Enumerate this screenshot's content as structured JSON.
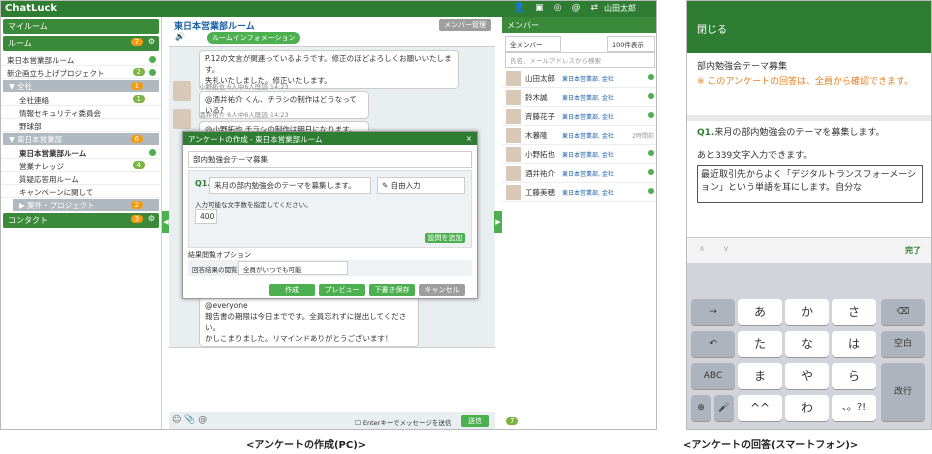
{
  "pc": {
    "app_title": "ChatLuck",
    "user_name": "山田太郎",
    "sidebar": {
      "my_room": "マイルーム",
      "rooms_header": "ルーム",
      "rooms_badge": "7",
      "items": [
        "東日本営業部ルーム",
        "新企画立ち上げプロジェクト"
      ],
      "item_badge": "2",
      "group_all": "全社",
      "group_all_badge": "1",
      "all_items": [
        "全社連絡",
        "情報セキュリティ委員会",
        "野球部"
      ],
      "all_badge": "1",
      "group_east": "東日本営業部",
      "group_east_badge": "6",
      "east_items": [
        "東日本営業部ルーム",
        "営業ナレッジ",
        "質疑応答用ルーム",
        "キャンペーンに関して"
      ],
      "east_badge": "4",
      "group_proj": "案件・プロジェクト",
      "group_proj_badge": "2",
      "contacts": "コンタクト",
      "contacts_badge": "3"
    },
    "chat": {
      "room_title": "東日本営業部ルーム",
      "manage_btn": "メンバー管理",
      "room_info": "ルームインフォメーション",
      "m1": "P.12の文言が関連っているようです。修正のほどよろしくお願いいたします。",
      "m1b": "失礼いたしました。修正いたします。",
      "meta2": "小野拓也 6人中6人既読 14:23",
      "m2": "@酒井祐介 くん、チラシの制作はどうなっている？",
      "meta3": "酒井祐介 6人中6人既読 14:23",
      "m3": "@小野拓也 チラシの制作は明日になります。",
      "m4a": "@everyone",
      "m4b": "報告書の期限は今日までです。全員忘れずに提出してください。",
      "m4c": "かしこまりました。リマインドありがとうございます！",
      "enter_send": "Enterキーでメッセージを送信",
      "send": "送信"
    },
    "modal": {
      "title": "アンケートの作成 - 東日本営業部ルーム",
      "close": "×",
      "survey_title": "部内勉強会テーマ募集",
      "q_label": "Q1.",
      "q_text": "来月の部内勉強会のテーマを募集します。",
      "q_type": "自由入力",
      "limit_label": "入力可能な文字数を指定してください。",
      "limit_value": "400",
      "add_q": "設問を追加",
      "result_option": "結果閲覧オプション",
      "view_label": "回答結果の閲覧：",
      "view_value": "全員がいつでも可能",
      "btn_create": "作成",
      "btn_preview": "プレビュー",
      "btn_draft": "下書き保存",
      "btn_cancel": "キャンセル"
    },
    "members": {
      "title": "メンバー",
      "filter": "全メンバー",
      "sort": "100件表示",
      "search_placeholder": "氏名、メールアドレスから検索",
      "list": [
        {
          "name": "山田太郎",
          "dept": "東日本営業部",
          "co": "金社"
        },
        {
          "name": "鈴木誠",
          "dept": "東日本営業部",
          "co": "金社"
        },
        {
          "name": "斉藤花子",
          "dept": "東日本営業部",
          "co": "金社"
        },
        {
          "name": "木暮隆",
          "dept": "東日本営業部",
          "co": "金社",
          "time": "2時間前"
        },
        {
          "name": "小野拓也",
          "dept": "東日本営業部",
          "co": "金社"
        },
        {
          "name": "酒井祐介",
          "dept": "東日本営業部",
          "co": "金社"
        },
        {
          "name": "工藤美穂",
          "dept": "東日本営業部",
          "co": "金社"
        }
      ],
      "count": "7"
    }
  },
  "phone": {
    "close": "閉じる",
    "survey_title": "部内勉強会テーマ募集",
    "notice": "※ このアンケートの回答は、全員から確認できます。",
    "q_label": "Q1.",
    "q_text": "来月の部内勉強会のテーマを募集します。",
    "remaining": "あと339文字入力できます。",
    "answer": "最近取引先からよく「デジタルトランスフォーメーション」という単語を耳にします。自分な",
    "done": "完了",
    "keys": [
      "あ",
      "か",
      "さ",
      "た",
      "な",
      "は",
      "ま",
      "や",
      "ら",
      "わ",
      "、。?!"
    ],
    "k_space": "空白",
    "k_return": "改行",
    "k_abc": "ABC"
  },
  "captions": {
    "pc": "<アンケートの作成(PC)>",
    "phone": "<アンケートの回答(スマートフォン)>"
  }
}
